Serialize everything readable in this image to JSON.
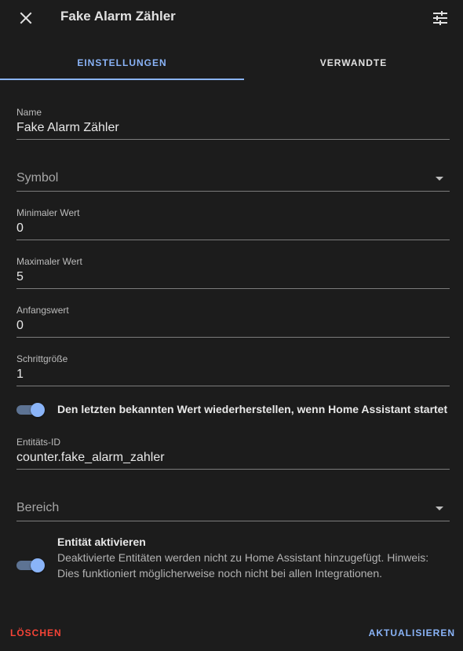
{
  "header": {
    "title": "Fake Alarm Zähler",
    "close_icon": "close-icon",
    "settings_icon": "tune-icon"
  },
  "tabs": [
    {
      "label": "EINSTELLUNGEN",
      "active": true
    },
    {
      "label": "VERWANDTE",
      "active": false
    }
  ],
  "form": {
    "name": {
      "label": "Name",
      "value": "Fake Alarm Zähler"
    },
    "symbol": {
      "placeholder": "Symbol"
    },
    "minimum": {
      "label": "Minimaler Wert",
      "value": "0"
    },
    "maximum": {
      "label": "Maximaler Wert",
      "value": "5"
    },
    "initial": {
      "label": "Anfangswert",
      "value": "0"
    },
    "step": {
      "label": "Schrittgröße",
      "value": "1"
    },
    "restore": {
      "label": "Den letzten bekannten Wert wiederherstellen, wenn Home Assistant startet",
      "checked": true
    },
    "entity_id": {
      "label": "Entitäts-ID",
      "value": "counter.fake_alarm_zahler"
    },
    "area": {
      "placeholder": "Bereich"
    },
    "enable": {
      "title": "Entität aktivieren",
      "description": "Deaktivierte Entitäten werden nicht zu Home Assistant hinzugefügt. Hinweis: Dies funktioniert möglicherweise noch nicht bei allen Integrationen.",
      "checked": true
    }
  },
  "footer": {
    "delete_label": "LÖSCHEN",
    "update_label": "AKTUALISIEREN"
  },
  "colors": {
    "accent": "#8ab4f8",
    "danger": "#f44336",
    "background": "#1c1c1c"
  }
}
